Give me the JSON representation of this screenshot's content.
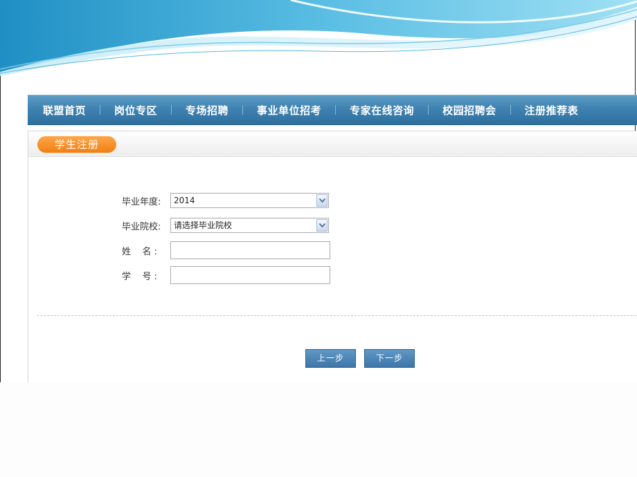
{
  "nav": {
    "items": [
      {
        "label": "联盟首页"
      },
      {
        "label": "岗位专区"
      },
      {
        "label": "专场招聘"
      },
      {
        "label": "事业单位招考"
      },
      {
        "label": "专家在线咨询"
      },
      {
        "label": "校园招聘会"
      },
      {
        "label": "注册推荐表"
      }
    ]
  },
  "panel": {
    "title": "学生注册"
  },
  "form": {
    "year": {
      "label": "毕业年度:",
      "value": "2014"
    },
    "school": {
      "label": "毕业院校:",
      "value": "请选择毕业院校"
    },
    "name": {
      "label": "姓    名 :",
      "value": ""
    },
    "student_id": {
      "label": "学    号 :",
      "value": ""
    }
  },
  "buttons": {
    "prev": "上一步",
    "next": "下一步"
  },
  "colors": {
    "nav_bg": "#3f82b1",
    "title_pill": "#f39026",
    "button_bg": "#4a84b5"
  }
}
